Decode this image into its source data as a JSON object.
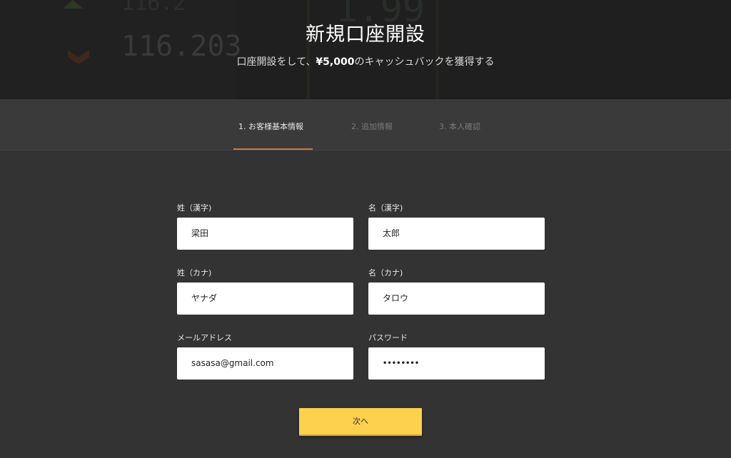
{
  "hero": {
    "title": "新規口座開設",
    "subtitle_prefix": "口座開設をして、",
    "subtitle_amount": "¥5,000",
    "subtitle_suffix": "のキャッシュバックを獲得する",
    "bg_ticker_1": "116.203",
    "bg_ticker_2": "1.99"
  },
  "steps": [
    {
      "label": "1. お客様基本情報",
      "active": true
    },
    {
      "label": "2. 追加情報",
      "active": false
    },
    {
      "label": "3. 本人確認",
      "active": false
    }
  ],
  "form": {
    "last_name_kanji": {
      "label": "姓（漢字)",
      "value": "梁田"
    },
    "first_name_kanji": {
      "label": "名（漢字)",
      "value": "太郎"
    },
    "last_name_kana": {
      "label": "姓（カナ)",
      "value": "ヤナダ"
    },
    "first_name_kana": {
      "label": "名（カナ)",
      "value": "タロウ"
    },
    "email": {
      "label": "メールアドレス",
      "value": "sasasa@gmail.com"
    },
    "password": {
      "label": "パスワード",
      "value": "••••••••"
    }
  },
  "next_button": {
    "label": "次へ"
  },
  "colors": {
    "accent_underline": "#c87a48",
    "button": "#fdd04e",
    "background": "#333333"
  }
}
